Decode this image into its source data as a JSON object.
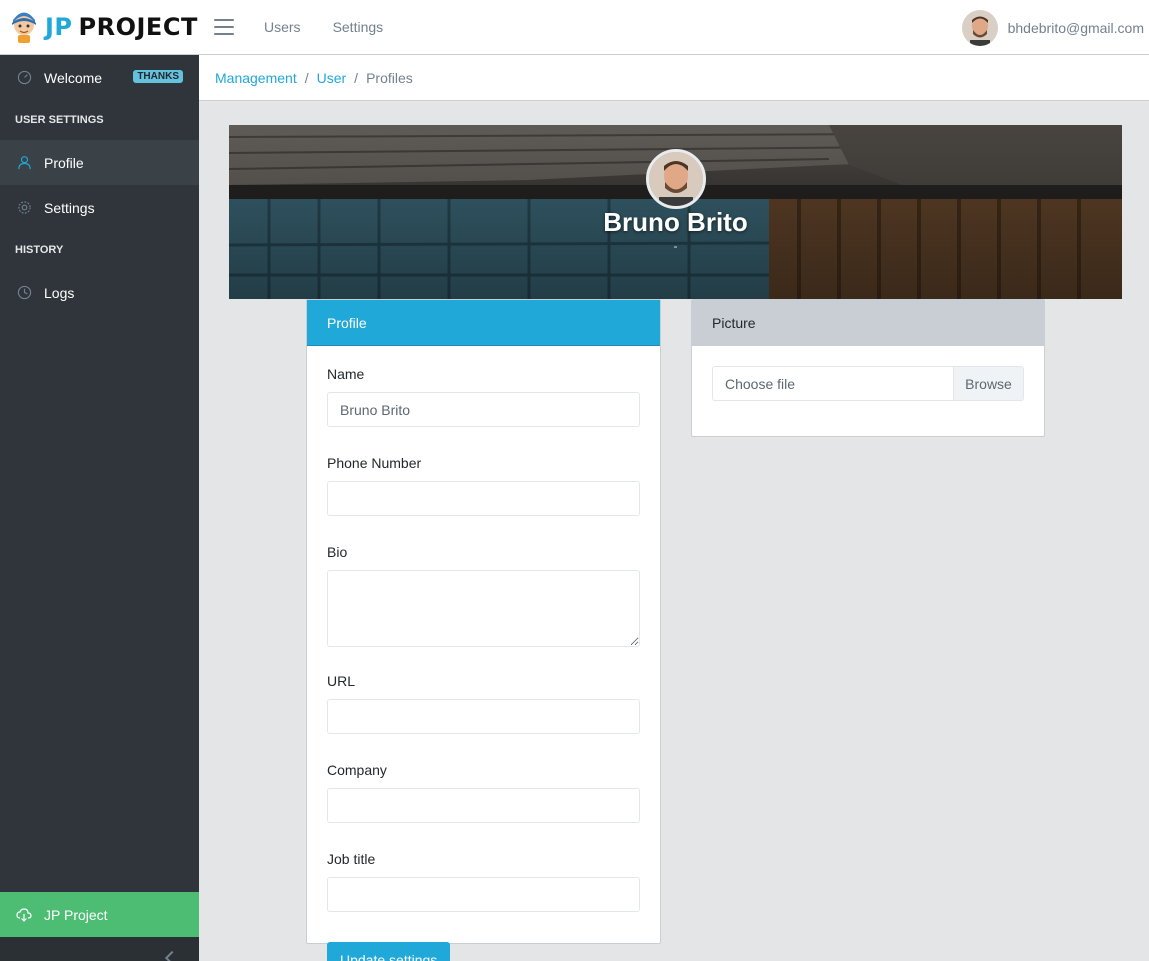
{
  "brand": {
    "jp": "JP",
    "project": "PROJECT"
  },
  "header": {
    "nav": [
      "Users",
      "Settings"
    ],
    "user_email": "bhdebrito@gmail.com"
  },
  "sidebar": {
    "welcome": {
      "label": "Welcome",
      "badge": "THANKS"
    },
    "section_user_settings": "USER SETTINGS",
    "profile": "Profile",
    "settings": "Settings",
    "section_history": "HISTORY",
    "logs": "Logs",
    "footer": "JP Project"
  },
  "breadcrumb": {
    "items": [
      "Management",
      "User"
    ],
    "current": "Profiles"
  },
  "banner": {
    "name": "Bruno Brito",
    "subtitle": "-"
  },
  "profile_form": {
    "title": "Profile",
    "name_label": "Name",
    "name_value": "Bruno Brito",
    "phone_label": "Phone Number",
    "phone_value": "",
    "bio_label": "Bio",
    "bio_value": "",
    "url_label": "URL",
    "url_value": "",
    "company_label": "Company",
    "company_value": "",
    "job_label": "Job title",
    "job_value": "",
    "submit": "Update settings"
  },
  "picture": {
    "title": "Picture",
    "file_placeholder": "Choose file",
    "browse": "Browse"
  },
  "colors": {
    "primary": "#20a8d8",
    "sidebar": "#2f353a",
    "success": "#4dbd74",
    "badge": "#63c2de"
  }
}
